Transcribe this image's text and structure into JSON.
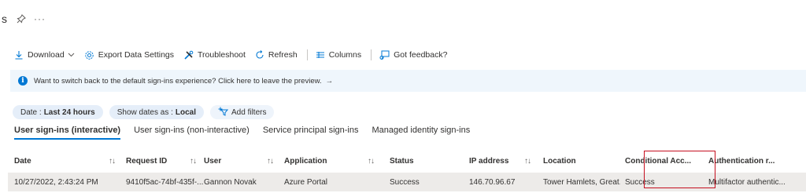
{
  "title": {
    "fragment": "s",
    "more_label": "···"
  },
  "toolbar": {
    "download": "Download",
    "export": "Export Data Settings",
    "troubleshoot": "Troubleshoot",
    "refresh": "Refresh",
    "columns": "Columns",
    "feedback": "Got feedback?"
  },
  "banner": {
    "text": "Want to switch back to the default sign-ins experience? Click here to leave the preview.",
    "arrow": "→"
  },
  "filters": {
    "date_label": "Date :",
    "date_value": "Last 24 hours",
    "show_dates_label": "Show dates as :",
    "show_dates_value": "Local",
    "add_filters": "Add filters"
  },
  "tabs": [
    {
      "label": "User sign-ins (interactive)",
      "active": true
    },
    {
      "label": "User sign-ins (non-interactive)",
      "active": false
    },
    {
      "label": "Service principal sign-ins",
      "active": false
    },
    {
      "label": "Managed identity sign-ins",
      "active": false
    }
  ],
  "table": {
    "columns": [
      "Date",
      "Request ID",
      "User",
      "Application",
      "Status",
      "IP address",
      "Location",
      "Conditional Acc...",
      "Authentication r..."
    ],
    "sort_glyph": "↑↓",
    "rows": [
      [
        "10/27/2022, 2:43:24 PM",
        "9410f5ac-74bf-435f-...",
        "Gannon Novak",
        "Azure Portal",
        "Success",
        "146.70.96.67",
        "Tower Hamlets, Great...",
        "Success",
        "Multifactor authentic..."
      ]
    ]
  },
  "colors": {
    "accent": "#0078d4",
    "banner_bg": "#eff6fc",
    "highlight_border": "#c50f1f",
    "row_bg": "#edebe9"
  }
}
